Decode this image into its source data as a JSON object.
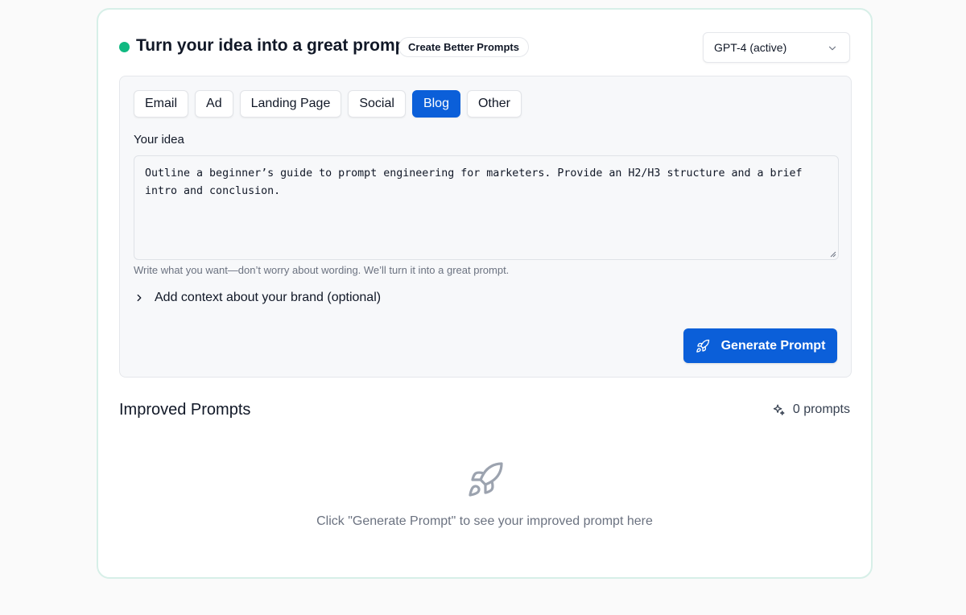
{
  "header": {
    "title": "Turn your idea into a great prompt",
    "badge": "Create Better Prompts",
    "model_select": {
      "value": "GPT-4 (active)",
      "icon": "chevron-down-icon"
    },
    "status_color": "#10b981"
  },
  "tabs": [
    {
      "label": "Email",
      "active": false
    },
    {
      "label": "Ad",
      "active": false
    },
    {
      "label": "Landing Page",
      "active": false
    },
    {
      "label": "Social",
      "active": false
    },
    {
      "label": "Blog",
      "active": true
    },
    {
      "label": "Other",
      "active": false
    }
  ],
  "idea": {
    "label": "Your idea",
    "value": "Outline a beginner’s guide to prompt engineering for marketers. Provide an H2/H3 structure and a brief intro and conclusion.",
    "hint": "Write what you want—don’t worry about wording. We’ll turn it into a great prompt."
  },
  "context_toggle": {
    "label": "Add context about your brand (optional)",
    "icon": "chevron-right-icon"
  },
  "generate_button": {
    "label": "Generate Prompt",
    "icon": "rocket-icon"
  },
  "results": {
    "title": "Improved Prompts",
    "count_label": "0 prompts",
    "count_icon": "sparkles-icon",
    "empty_message": "Click \"Generate Prompt\" to see your improved prompt here",
    "empty_icon": "rocket-icon"
  },
  "colors": {
    "accent": "#0b5fd9",
    "card_border": "#d7efe8"
  }
}
